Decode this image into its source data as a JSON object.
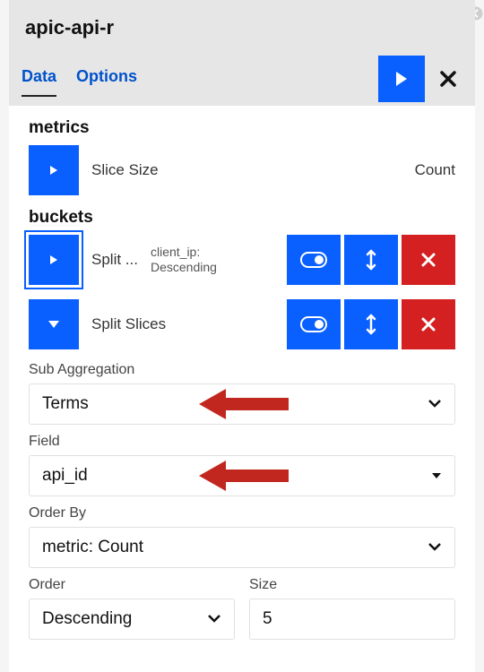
{
  "header": {
    "title": "apic-api-r"
  },
  "tabs": {
    "data": "Data",
    "options": "Options",
    "active": "data"
  },
  "metrics": {
    "section": "metrics",
    "items": [
      {
        "label": "Slice Size",
        "value": "Count"
      }
    ]
  },
  "buckets": {
    "section": "buckets",
    "items": [
      {
        "label": "Split ...",
        "desc1": "client_ip:",
        "desc2": "Descending",
        "expanded": false
      },
      {
        "label": "Split Slices",
        "expanded": true
      }
    ]
  },
  "form": {
    "sub_agg_label": "Sub Aggregation",
    "sub_agg_value": "Terms",
    "field_label": "Field",
    "field_value": "api_id",
    "order_by_label": "Order By",
    "order_by_value": "metric: Count",
    "order_label": "Order",
    "order_value": "Descending",
    "size_label": "Size",
    "size_value": "5"
  }
}
